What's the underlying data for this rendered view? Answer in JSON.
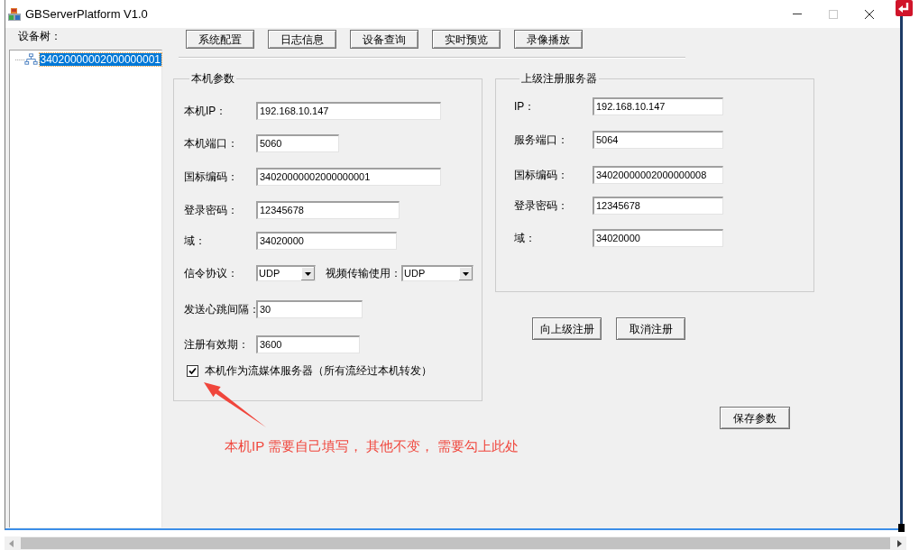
{
  "window": {
    "title": "GBServerPlatform V1.0"
  },
  "device_tree": {
    "label": "设备树：",
    "items": [
      {
        "label": "34020000002000000001",
        "selected": true
      }
    ]
  },
  "toolbar": [
    "系统配置",
    "日志信息",
    "设备查询",
    "实时预览",
    "录像播放"
  ],
  "local_params": {
    "title": "本机参数",
    "rows": [
      {
        "fields": [
          {
            "kind": "input",
            "label": "本机IP：",
            "value": "192.168.10.147"
          }
        ]
      },
      {
        "fields": [
          {
            "kind": "input",
            "label": "本机端口：",
            "value": "5060"
          }
        ]
      },
      {
        "fields": [
          {
            "kind": "input",
            "label": "国标编码：",
            "value": "34020000002000000001"
          }
        ]
      },
      {
        "fields": [
          {
            "kind": "input",
            "label": "登录密码：",
            "value": "12345678"
          }
        ]
      },
      {
        "fields": [
          {
            "kind": "input",
            "label": "域：",
            "value": "34020000"
          }
        ]
      },
      {
        "fields": [
          {
            "kind": "select",
            "label": "信令协议：",
            "value": "UDP"
          },
          {
            "kind": "select",
            "label": "视频传输使用：",
            "value": "UDP"
          }
        ]
      },
      {
        "fields": [
          {
            "kind": "input",
            "label": "发送心跳间隔：",
            "value": "30"
          }
        ]
      },
      {
        "fields": [
          {
            "kind": "input",
            "label": "注册有效期：",
            "value": "3600"
          }
        ]
      }
    ],
    "checkbox": {
      "label": "本机作为流媒体服务器（所有流经过本机转发）",
      "checked": true
    }
  },
  "upstream_server": {
    "title": "上级注册服务器",
    "fields": [
      {
        "label": "IP：",
        "value": "192.168.10.147"
      },
      {
        "label": "服务端口：",
        "value": "5064"
      },
      {
        "label": "国标编码：",
        "value": "34020000002000000008"
      },
      {
        "label": "登录密码：",
        "value": "12345678"
      },
      {
        "label": "域：",
        "value": "34020000"
      }
    ],
    "buttons": [
      "向上级注册",
      "取消注册"
    ]
  },
  "save_button": "保存参数",
  "annotation": {
    "text": "本机IP 需要自己填写， 其他不变， 需要勾上此处"
  }
}
